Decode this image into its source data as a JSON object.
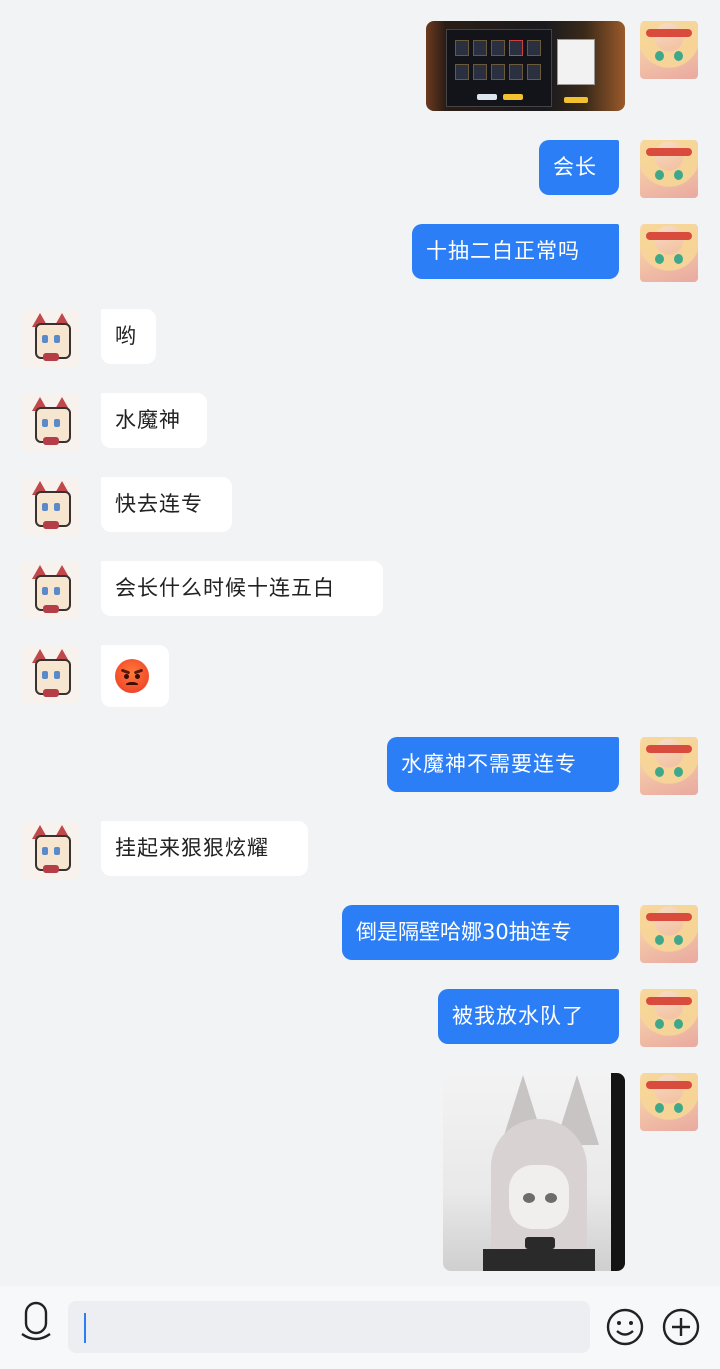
{
  "conversation": {
    "messages": [
      {
        "id": "m1",
        "sender": "me",
        "type": "image",
        "image": "game-gacha-screenshot"
      },
      {
        "id": "m2",
        "sender": "me",
        "type": "text",
        "text": "会长"
      },
      {
        "id": "m3",
        "sender": "me",
        "type": "text",
        "text": "十抽二白正常吗"
      },
      {
        "id": "m4",
        "sender": "other",
        "type": "text",
        "text": "哟"
      },
      {
        "id": "m5",
        "sender": "other",
        "type": "text",
        "text": "水魔神"
      },
      {
        "id": "m6",
        "sender": "other",
        "type": "text",
        "text": "快去连专"
      },
      {
        "id": "m7",
        "sender": "other",
        "type": "text",
        "text": "会长什么时候十连五白"
      },
      {
        "id": "m8",
        "sender": "other",
        "type": "emoji",
        "emoji": "angry-face"
      },
      {
        "id": "m9",
        "sender": "me",
        "type": "text",
        "text": "水魔神不需要连专"
      },
      {
        "id": "m10",
        "sender": "other",
        "type": "text",
        "text": "挂起来狠狠炫耀"
      },
      {
        "id": "m11",
        "sender": "me",
        "type": "text",
        "text": "倒是隔壁哈娜30抽连专"
      },
      {
        "id": "m12",
        "sender": "me",
        "type": "text",
        "text": "被我放水队了"
      },
      {
        "id": "m13",
        "sender": "me",
        "type": "image",
        "image": "anime-foxgirl-picture"
      }
    ]
  },
  "input_bar": {
    "value": "",
    "icons": [
      "microphone-icon",
      "emoji-icon",
      "plus-icon"
    ]
  },
  "colors": {
    "background": "#f2f3f5",
    "my_bubble": "#2b7ef5",
    "other_bubble": "#ffffff",
    "accent": "#2b7ef5"
  }
}
